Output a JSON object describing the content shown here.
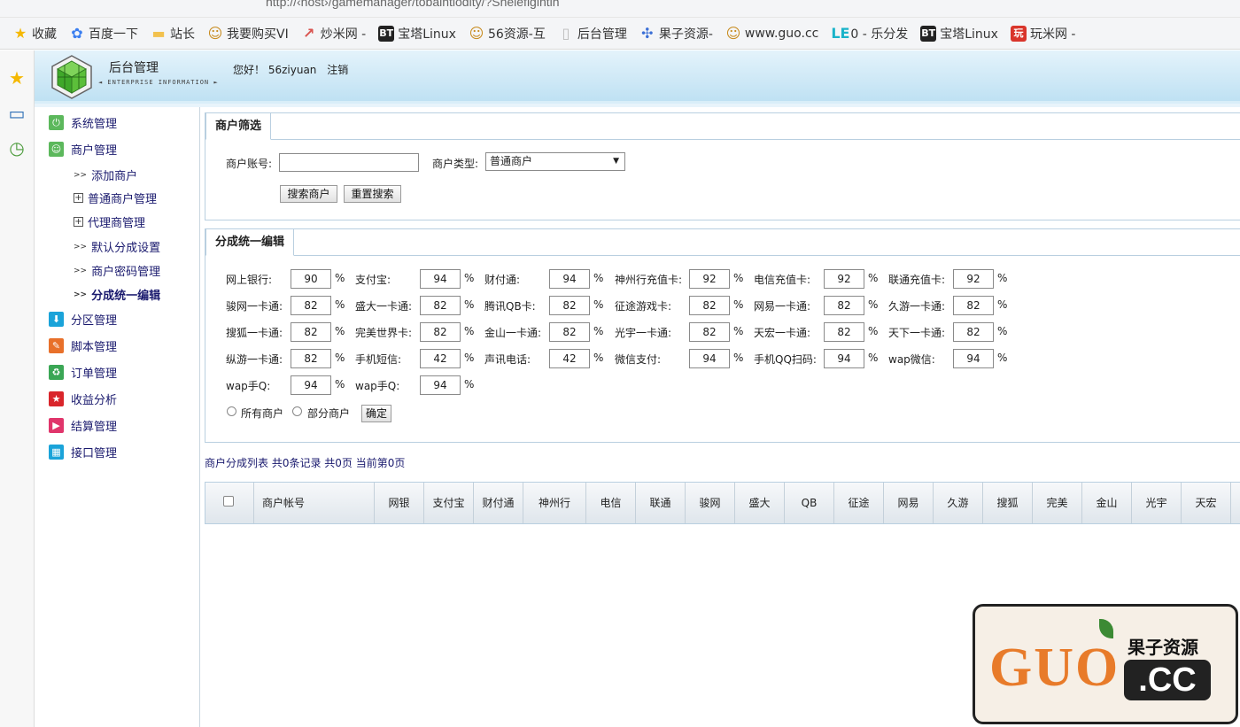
{
  "browser": {
    "address": "http://‹host›/gamemanager/tobaintiodity/?Sheiefigintin",
    "bookmarks": [
      {
        "label": "收藏",
        "icon": "star-icon",
        "color": "#f5b800"
      },
      {
        "label": "百度一下",
        "icon": "baidu-paw-icon",
        "color": "#3a7ef0"
      },
      {
        "label": "站长",
        "icon": "folder-icon",
        "color": "#f2c14e"
      },
      {
        "label": "我要购买VI",
        "icon": "smiley-icon",
        "color": "#c78a1c"
      },
      {
        "label": "炒米网 -",
        "icon": "chart-line-icon",
        "color": "#d9534f"
      },
      {
        "label": "宝塔Linux",
        "icon": "bt-icon",
        "color": "#222222"
      },
      {
        "label": "56资源-互",
        "icon": "smiley-icon",
        "color": "#c78a1c"
      },
      {
        "label": "后台管理",
        "icon": "page-icon",
        "color": "#bbbbbb"
      },
      {
        "label": "果子资源-",
        "icon": "dots-icon",
        "color": "#3b6fd6"
      },
      {
        "label": "www.guo.cc",
        "icon": "smiley-icon",
        "color": "#c78a1c"
      },
      {
        "label": "0 - 乐分发",
        "icon": "le-icon",
        "color": "#19b3c9"
      },
      {
        "label": "宝塔Linux",
        "icon": "bt-icon",
        "color": "#222222"
      },
      {
        "label": "玩米网 -",
        "icon": "wan-icon",
        "color": "#d9352b"
      }
    ]
  },
  "header": {
    "title": "后台管理",
    "subtitle": "◄ ENTERPRISE INFORMATION ►",
    "greeting": "您好！",
    "username": "56ziyuan",
    "logout": "注销"
  },
  "menu": {
    "items": [
      {
        "label": "系统管理",
        "icon": "power-icon",
        "color": "#5cb85c"
      },
      {
        "label": "商户管理",
        "icon": "smile-icon",
        "color": "#5cb85c"
      },
      {
        "label": "分区管理",
        "icon": "download-icon",
        "color": "#1aa3d9"
      },
      {
        "label": "脚本管理",
        "icon": "pencil-icon",
        "color": "#e8702a"
      },
      {
        "label": "订单管理",
        "icon": "recycle-icon",
        "color": "#3aa655"
      },
      {
        "label": "收益分析",
        "icon": "star-icon",
        "color": "#d9252b"
      },
      {
        "label": "结算管理",
        "icon": "play-icon",
        "color": "#e0356b"
      },
      {
        "label": "接口管理",
        "icon": "grid-icon",
        "color": "#1aa3d9"
      }
    ],
    "subitems": [
      {
        "label": "添加商户",
        "prefix": ">>"
      },
      {
        "label": "普通商户管理",
        "prefix": "+"
      },
      {
        "label": "代理商管理",
        "prefix": "+"
      },
      {
        "label": "默认分成设置",
        "prefix": ">>"
      },
      {
        "label": "商户密码管理",
        "prefix": ">>"
      },
      {
        "label": "分成统一编辑",
        "prefix": ">>"
      }
    ]
  },
  "filter": {
    "tab": "商户筛选",
    "account_label": "商户账号:",
    "account_value": "",
    "type_label": "商户类型:",
    "type_value": "普通商户",
    "search_btn": "搜索商户",
    "reset_btn": "重置搜索"
  },
  "edit": {
    "tab": "分成统一编辑",
    "percent": "%",
    "fields": [
      {
        "label": "网上银行:",
        "value": "90"
      },
      {
        "label": "支付宝:",
        "value": "94"
      },
      {
        "label": "财付通:",
        "value": "94"
      },
      {
        "label": "神州行充值卡:",
        "value": "92"
      },
      {
        "label": "电信充值卡:",
        "value": "92"
      },
      {
        "label": "联通充值卡:",
        "value": "92"
      },
      {
        "label": "骏网一卡通:",
        "value": "82"
      },
      {
        "label": "盛大一卡通:",
        "value": "82"
      },
      {
        "label": "腾讯QB卡:",
        "value": "82"
      },
      {
        "label": "征途游戏卡:",
        "value": "82"
      },
      {
        "label": "网易一卡通:",
        "value": "82"
      },
      {
        "label": "久游一卡通:",
        "value": "82"
      },
      {
        "label": "搜狐一卡通:",
        "value": "82"
      },
      {
        "label": "完美世界卡:",
        "value": "82"
      },
      {
        "label": "金山一卡通:",
        "value": "82"
      },
      {
        "label": "光宇一卡通:",
        "value": "82"
      },
      {
        "label": "天宏一卡通:",
        "value": "82"
      },
      {
        "label": "天下一卡通:",
        "value": "82"
      },
      {
        "label": "纵游一卡通:",
        "value": "82"
      },
      {
        "label": "手机短信:",
        "value": "42"
      },
      {
        "label": "声讯电话:",
        "value": "42"
      },
      {
        "label": "微信支付:",
        "value": "94"
      },
      {
        "label": "手机QQ扫码:",
        "value": "94"
      },
      {
        "label": "wap微信:",
        "value": "94"
      },
      {
        "label": "wap手Q:",
        "value": "94"
      },
      {
        "label": "wap手Q:",
        "value": "94"
      }
    ],
    "radio_all": "所有商户",
    "radio_part": "部分商户",
    "confirm_btn": "确定"
  },
  "list": {
    "info": "商户分成列表 共0条记录 共0页 当前第0页",
    "columns": [
      "商户帐号",
      "网银",
      "支付宝",
      "财付通",
      "神州行",
      "电信",
      "联通",
      "骏网",
      "盛大",
      "QB",
      "征途",
      "网易",
      "久游",
      "搜狐",
      "完美",
      "金山",
      "光宇",
      "天宏"
    ]
  },
  "watermark": {
    "latin": "GUO",
    "cn": "果子资源",
    "domain": ".CC"
  }
}
